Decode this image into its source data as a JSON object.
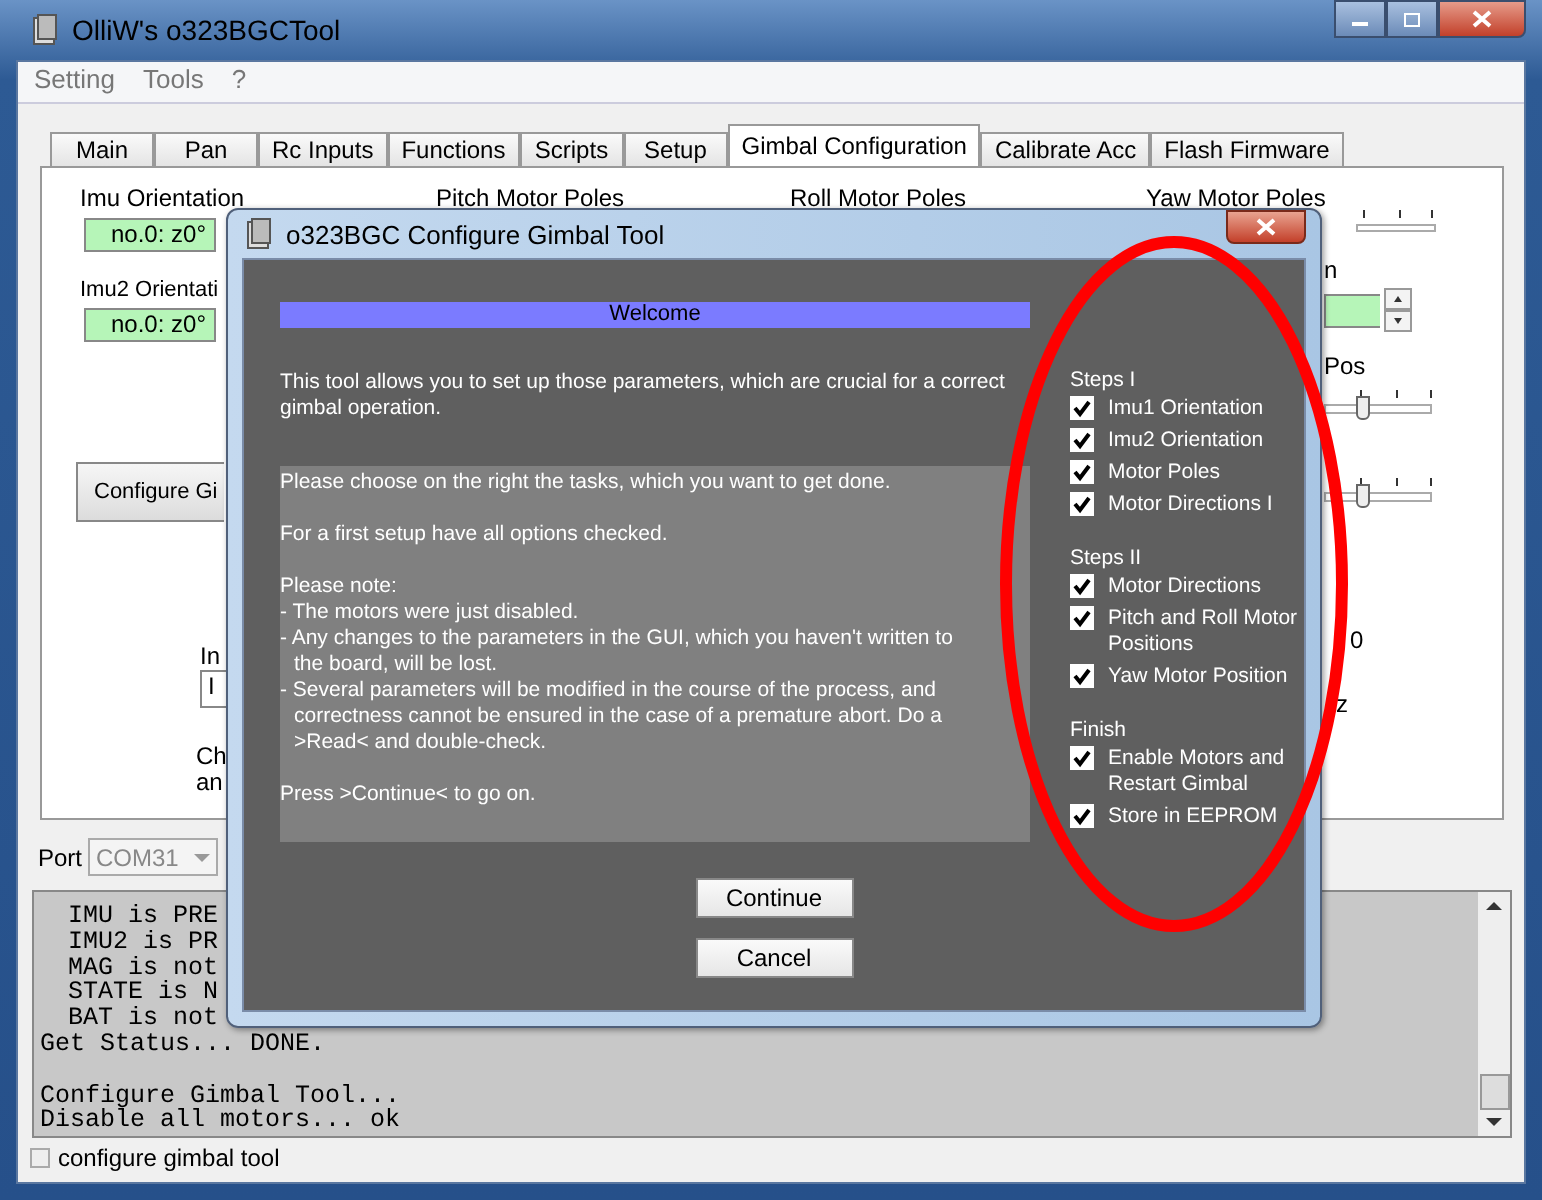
{
  "window": {
    "title": "OlliW's o323BGCTool"
  },
  "menu": [
    "Setting",
    "Tools",
    "?"
  ],
  "tabs": [
    {
      "label": "Main",
      "selected": false
    },
    {
      "label": "Pan",
      "selected": false
    },
    {
      "label": "Rc Inputs",
      "selected": false
    },
    {
      "label": "Functions",
      "selected": false
    },
    {
      "label": "Scripts",
      "selected": false
    },
    {
      "label": "Setup",
      "selected": false
    },
    {
      "label": "Gimbal Configuration",
      "selected": true
    },
    {
      "label": "Calibrate Acc",
      "selected": false
    },
    {
      "label": "Flash Firmware",
      "selected": false
    }
  ],
  "gimbal_configuration": {
    "headers": [
      "Imu Orientation",
      "Pitch Motor Poles",
      "Roll Motor Poles",
      "Yaw Motor Poles"
    ],
    "imu_orientation": "no.0: z0°",
    "imu2_label": "Imu2 Orientati",
    "imu2_orientation": "no.0: z0°",
    "sliders": [
      {
        "level": 0.3
      },
      {
        "level": 0.3
      }
    ],
    "configure_button": "Configure Gi",
    "cut_label": "In",
    "cut_field": "I",
    "cut_note": [
      "Ch",
      "an"
    ],
    "right_labels": [
      "n",
      "Pos",
      "0",
      "z"
    ]
  },
  "port": {
    "label": "Port",
    "value": "COM31"
  },
  "log": [
    [
      {
        "text": "IMU is PRE",
        "indented": true
      },
      {
        "text": "IMU2 is PR",
        "indented": true
      },
      {
        "text": "MAG is not",
        "indented": true
      },
      {
        "text": "STATE is N",
        "indented": true
      },
      {
        "text": "BAT is not",
        "indented": true
      },
      {
        "text": "Get Status... DONE.",
        "indented": false
      }
    ],
    [
      {
        "text": "Configure Gimbal Tool...",
        "indented": false
      },
      {
        "text": "Disable all motors... ok",
        "indented": false
      }
    ]
  ],
  "status_bar": {
    "label": "configure gimbal tool",
    "checked": false
  },
  "dialog": {
    "title": "o323BGC Configure Gimbal Tool",
    "heading": "Welcome",
    "intro": "This tool allows you to set up those parameters, which are crucial for a correct gimbal operation.",
    "instructions": [
      {
        "kind": "para",
        "text": "Please choose on the right the tasks, which you want to get done."
      },
      {
        "kind": "para",
        "text": "For a first setup have all options checked."
      },
      {
        "kind": "para",
        "text": "Please note:"
      },
      {
        "kind": "bullet",
        "text": "- The motors were just disabled."
      },
      {
        "kind": "bullet",
        "text": "- Any changes to the parameters in the GUI, which you haven't written to the board, will be lost."
      },
      {
        "kind": "bullet",
        "text": "- Several parameters will be modified in the course of the process, and correctness cannot be ensured in the case of a premature abort. Do a >Read< and double-check."
      },
      {
        "kind": "para",
        "text": "Press >Continue< to go on."
      }
    ],
    "groups": [
      {
        "title": "Steps I",
        "items": [
          {
            "label": "Imu1 Orientation",
            "checked": true
          },
          {
            "label": "Imu2 Orientation",
            "checked": true
          },
          {
            "label": "Motor Poles",
            "checked": true
          },
          {
            "label": "Motor Directions I",
            "checked": true
          }
        ]
      },
      {
        "title": "Steps II",
        "items": [
          {
            "label": "Motor Directions",
            "checked": true
          },
          {
            "label": "Pitch and Roll Motor Positions",
            "checked": true
          },
          {
            "label": "Yaw Motor Position",
            "checked": true
          }
        ]
      },
      {
        "title": "Finish",
        "items": [
          {
            "label": "Enable Motors and Restart Gimbal",
            "checked": true
          },
          {
            "label": "Store in EEPROM",
            "checked": true
          }
        ]
      }
    ],
    "buttons": [
      "Continue",
      "Cancel"
    ]
  }
}
